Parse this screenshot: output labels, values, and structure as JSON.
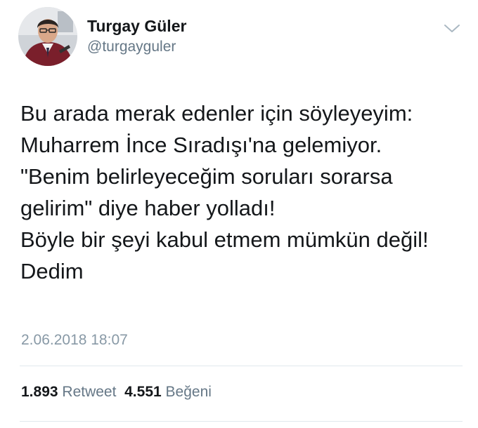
{
  "author": {
    "display_name": "Turgay Güler",
    "handle": "@turgayguler",
    "avatar_icon": "profile-photo"
  },
  "menu": {
    "icon": "chevron-down-icon"
  },
  "tweet": {
    "lines": [
      "Bu arada merak edenler için söyleyeyim:",
      "Muharrem İnce Sıradışı'na gelemiyor.",
      "\"Benim belirleyeceğim soruları sorarsa",
      "gelirim\" diye haber yolladı!",
      "Böyle bir şeyi kabul etmem mümkün değil!",
      "Dedim"
    ],
    "timestamp": "2.06.2018 18:07"
  },
  "stats": {
    "retweet_count": "1.893",
    "retweet_label": "Retweet",
    "like_count": "4.551",
    "like_label": "Beğeni"
  },
  "colors": {
    "text": "#14171a",
    "secondary": "#657786",
    "timestamp": "#8899a6",
    "divider": "#e1e8ed"
  }
}
